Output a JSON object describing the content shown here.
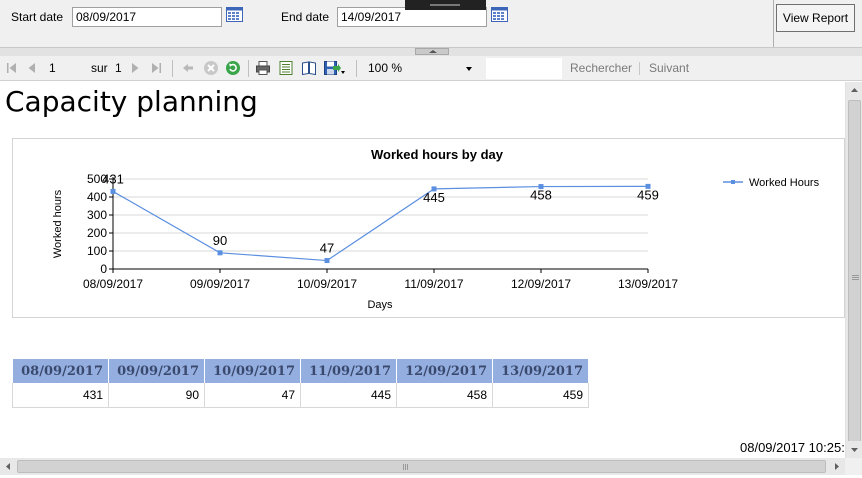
{
  "params": {
    "start_label": "Start date",
    "start_value": "08/09/2017",
    "end_label": "End date",
    "end_value": "14/09/2017",
    "view_report_label": "View Report"
  },
  "toolbar": {
    "page_value": "1",
    "of_label": "sur",
    "page_count": "1",
    "zoom": "100 %",
    "find_label": "Rechercher",
    "next_label": "Suivant",
    "icons": [
      "first-page-icon",
      "previous-page-icon",
      "next-page-icon",
      "last-page-icon",
      "back-icon",
      "stop-icon",
      "refresh-icon",
      "print-icon",
      "print-layout-icon",
      "page-setup-icon",
      "export-icon"
    ]
  },
  "report": {
    "title": "Capacity planning",
    "timestamp": "08/09/2017 10:25:"
  },
  "chart_data": {
    "type": "line",
    "title": "Worked hours by day",
    "xlabel": "Days",
    "ylabel": "Worked hours",
    "categories": [
      "08/09/2017",
      "09/09/2017",
      "10/09/2017",
      "11/09/2017",
      "12/09/2017",
      "13/09/2017"
    ],
    "series": [
      {
        "name": "Worked Hours",
        "values": [
          431,
          90,
          47,
          445,
          458,
          459
        ],
        "color": "#5b8fe0"
      }
    ],
    "ylim": [
      0,
      500
    ],
    "yticks": [
      "0",
      "100",
      "200",
      "300",
      "400",
      "500"
    ],
    "grid": true,
    "legend": "right"
  },
  "table": {
    "headers": [
      "08/09/2017",
      "09/09/2017",
      "10/09/2017",
      "11/09/2017",
      "12/09/2017",
      "13/09/2017"
    ],
    "values": [
      "431",
      "90",
      "47",
      "445",
      "458",
      "459"
    ],
    "header_color": "#94aee0"
  }
}
